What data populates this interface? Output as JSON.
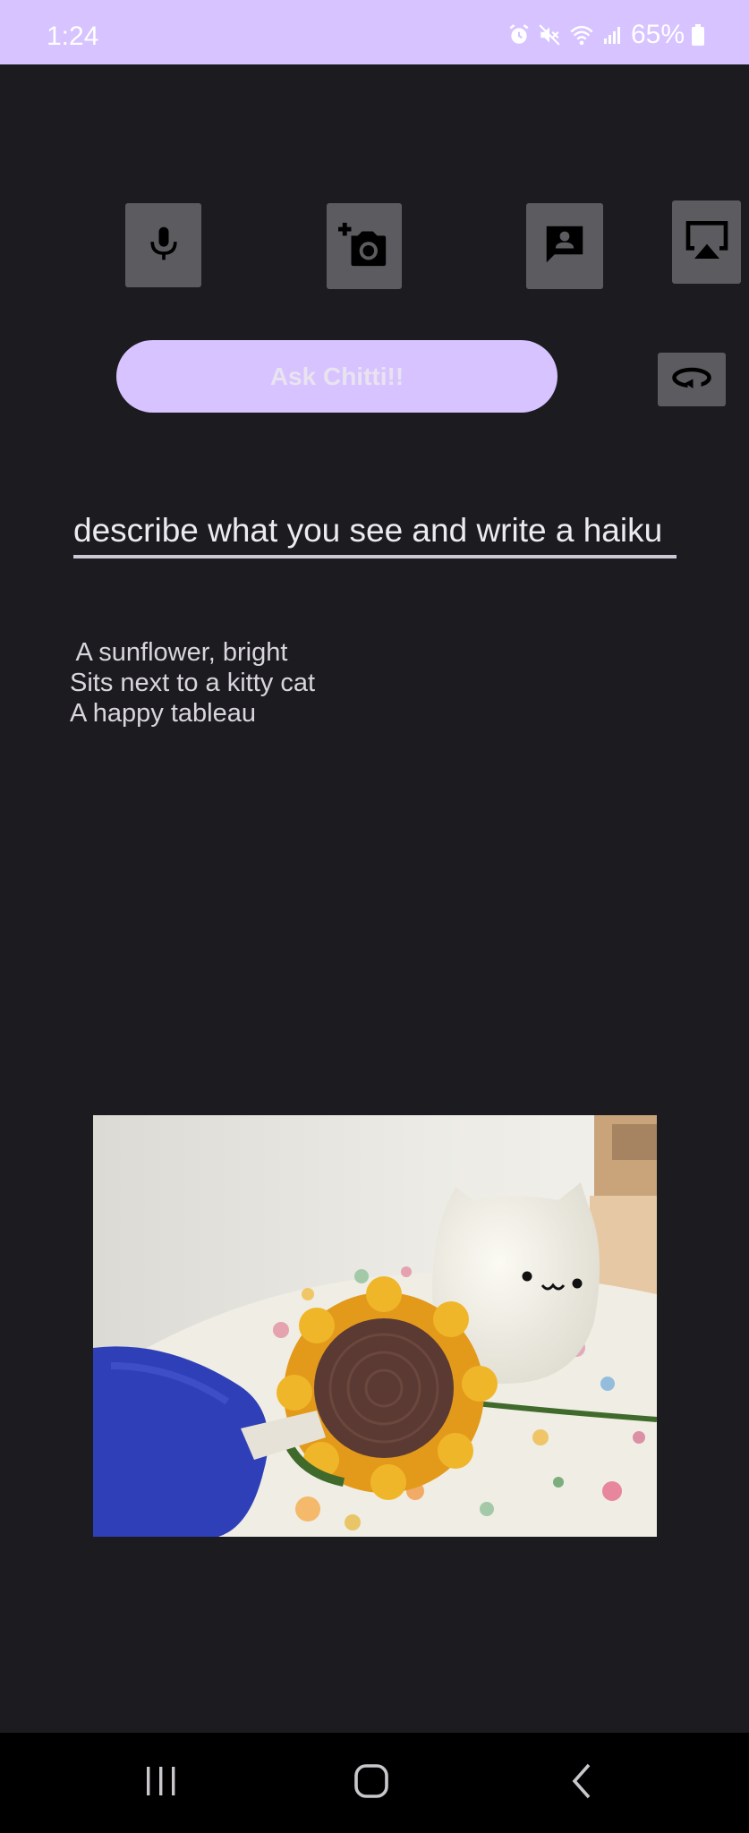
{
  "status_bar": {
    "time": "1:24",
    "battery": "65%",
    "icons": [
      "alarm-icon",
      "mute-icon",
      "wifi-icon",
      "signal-icon",
      "battery-icon"
    ]
  },
  "toolbar": {
    "buttons": [
      {
        "name": "microphone-button",
        "icon": "microphone-icon"
      },
      {
        "name": "add-photo-button",
        "icon": "add-camera-icon"
      },
      {
        "name": "chat-button",
        "icon": "person-chat-icon"
      },
      {
        "name": "cast-button",
        "icon": "airplay-icon"
      }
    ]
  },
  "ask_button": {
    "label": "Ask Chitti!!"
  },
  "reset_button": {
    "icon": "rotate-icon"
  },
  "prompt": {
    "value": "describe what you see and write a haiku"
  },
  "response": {
    "lines": [
      " A sunflower, bright",
      "Sits next to a kitty cat",
      "A happy tableau"
    ]
  },
  "photo": {
    "subject": "crocheted sunflower next to white cat lamp"
  },
  "colors": {
    "accent": "#d6c3ff",
    "background": "#1c1b20",
    "button_gray": "#5c5b60"
  },
  "nav_bar": {
    "items": [
      "recent-apps-icon",
      "home-icon",
      "back-icon"
    ]
  }
}
